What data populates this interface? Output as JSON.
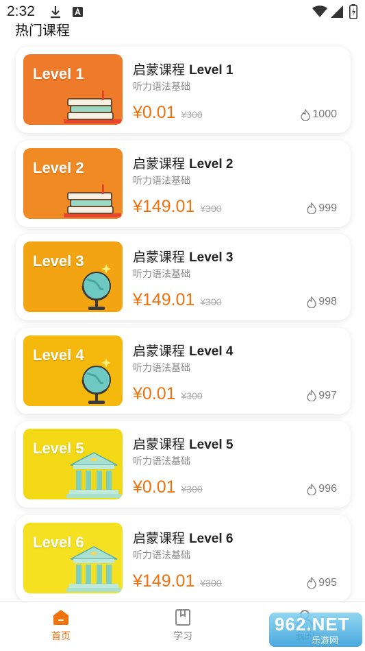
{
  "status_bar": {
    "time": "2:32",
    "icons": [
      "download-icon",
      "font-icon",
      "wifi-icon",
      "signal-icon",
      "battery-charging-icon"
    ]
  },
  "section_title": "热门课程",
  "courses": [
    {
      "thumb_label": "Level 1",
      "title_prefix": "启蒙课程",
      "title_level": "Level 1",
      "subtitle": "听力语法基础",
      "price": "¥0.01",
      "original_price": "¥300",
      "hot": "1000",
      "art": "books"
    },
    {
      "thumb_label": "Level 2",
      "title_prefix": "启蒙课程",
      "title_level": "Level 2",
      "subtitle": "听力语法基础",
      "price": "¥149.01",
      "original_price": "¥300",
      "hot": "999",
      "art": "books"
    },
    {
      "thumb_label": "Level 3",
      "title_prefix": "启蒙课程",
      "title_level": "Level 3",
      "subtitle": "听力语法基础",
      "price": "¥149.01",
      "original_price": "¥300",
      "hot": "998",
      "art": "globe"
    },
    {
      "thumb_label": "Level 4",
      "title_prefix": "启蒙课程",
      "title_level": "Level 4",
      "subtitle": "听力语法基础",
      "price": "¥0.01",
      "original_price": "¥300",
      "hot": "997",
      "art": "globe"
    },
    {
      "thumb_label": "Level 5",
      "title_prefix": "启蒙课程",
      "title_level": "Level 5",
      "subtitle": "听力语法基础",
      "price": "¥0.01",
      "original_price": "¥300",
      "hot": "996",
      "art": "building"
    },
    {
      "thumb_label": "Level 6",
      "title_prefix": "启蒙课程",
      "title_level": "Level 6",
      "subtitle": "听力语法基础",
      "price": "¥149.01",
      "original_price": "¥300",
      "hot": "995",
      "art": "building"
    }
  ],
  "tabbar": {
    "home_label": "首页",
    "study_label": "学习",
    "mine_label": "我的"
  },
  "watermark": {
    "big": "962.NET",
    "small": "乐游网"
  },
  "colors": {
    "accent": "#f0720f",
    "thumb_backgrounds": [
      "#ee7a2a",
      "#f08a24",
      "#f2a412",
      "#f5b80c",
      "#f3d816",
      "#f5e021"
    ]
  }
}
